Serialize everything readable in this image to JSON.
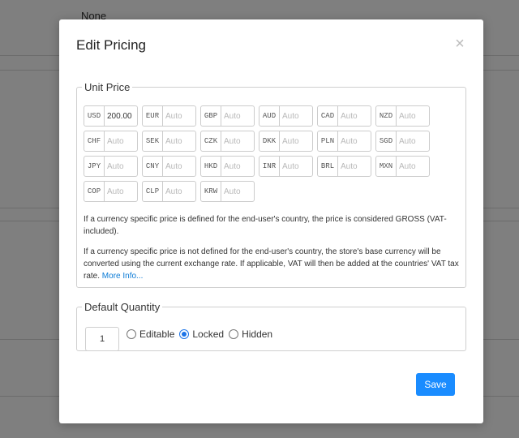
{
  "background": {
    "partial_text": "None"
  },
  "modal": {
    "title": "Edit Pricing",
    "close_glyph": "×",
    "unit_price": {
      "legend": "Unit Price",
      "currencies": [
        {
          "code": "USD",
          "value": "200.00",
          "placeholder": "Auto"
        },
        {
          "code": "EUR",
          "value": "",
          "placeholder": "Auto"
        },
        {
          "code": "GBP",
          "value": "",
          "placeholder": "Auto"
        },
        {
          "code": "AUD",
          "value": "",
          "placeholder": "Auto"
        },
        {
          "code": "CAD",
          "value": "",
          "placeholder": "Auto"
        },
        {
          "code": "NZD",
          "value": "",
          "placeholder": "Auto"
        },
        {
          "code": "CHF",
          "value": "",
          "placeholder": "Auto"
        },
        {
          "code": "SEK",
          "value": "",
          "placeholder": "Auto"
        },
        {
          "code": "CZK",
          "value": "",
          "placeholder": "Auto"
        },
        {
          "code": "DKK",
          "value": "",
          "placeholder": "Auto"
        },
        {
          "code": "PLN",
          "value": "",
          "placeholder": "Auto"
        },
        {
          "code": "SGD",
          "value": "",
          "placeholder": "Auto"
        },
        {
          "code": "JPY",
          "value": "",
          "placeholder": "Auto"
        },
        {
          "code": "CNY",
          "value": "",
          "placeholder": "Auto"
        },
        {
          "code": "HKD",
          "value": "",
          "placeholder": "Auto"
        },
        {
          "code": "INR",
          "value": "",
          "placeholder": "Auto"
        },
        {
          "code": "BRL",
          "value": "",
          "placeholder": "Auto"
        },
        {
          "code": "MXN",
          "value": "",
          "placeholder": "Auto"
        },
        {
          "code": "COP",
          "value": "",
          "placeholder": "Auto"
        },
        {
          "code": "CLP",
          "value": "",
          "placeholder": "Auto"
        },
        {
          "code": "KRW",
          "value": "",
          "placeholder": "Auto"
        }
      ],
      "info_1": "If a currency specific price is defined for the end-user's country, the price is considered GROSS (VAT-included).",
      "info_2": "If a currency specific price is not defined for the end-user's country, the store's base currency will be converted using the current exchange rate. If applicable, VAT will then be added at the countries' VAT tax rate.",
      "more_info_link": "More Info..."
    },
    "default_quantity": {
      "legend": "Default Quantity",
      "value": "1",
      "options": [
        {
          "label": "Editable",
          "selected": false
        },
        {
          "label": "Locked",
          "selected": true
        },
        {
          "label": "Hidden",
          "selected": false
        }
      ]
    },
    "save_label": "Save"
  },
  "colors": {
    "accent": "#1a8cff",
    "link": "#0a7ad6"
  }
}
